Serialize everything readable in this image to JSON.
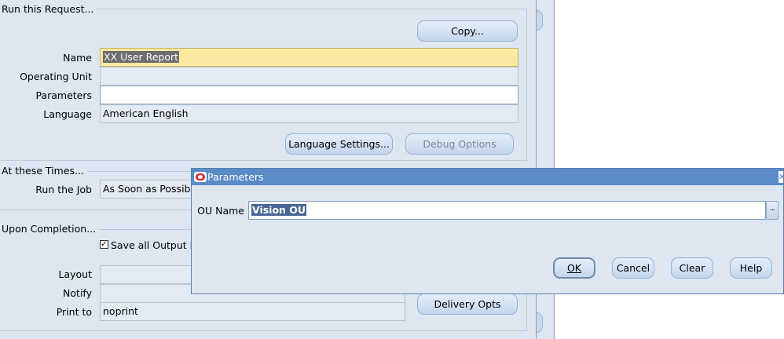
{
  "run_request": {
    "title": "Run this Request...",
    "copy_button": "Copy...",
    "name_label": "Name",
    "name_value": "XX User Report",
    "operating_unit_label": "Operating Unit",
    "operating_unit_value": "",
    "parameters_label": "Parameters",
    "parameters_value": "",
    "language_label": "Language",
    "language_value": "American English",
    "language_settings_button": "Language Settings...",
    "debug_options_button": "Debug Options"
  },
  "schedule": {
    "title": "At these Times...",
    "run_job_label": "Run the Job",
    "run_job_value": "As Soon as Possib"
  },
  "completion": {
    "title": "Upon Completion...",
    "save_output_checked": true,
    "save_output_label": "Save all Output F",
    "layout_label": "Layout",
    "layout_value": "",
    "notify_label": "Notify",
    "notify_value": "",
    "print_to_label": "Print to",
    "print_to_value": "noprint",
    "delivery_opts_button": "Delivery Opts"
  },
  "dialog": {
    "title": "Parameters",
    "ou_name_label": "OU Name",
    "ou_name_value": "Vision OU",
    "lov_label": "...",
    "ok_button": "OK",
    "cancel_button": "Cancel",
    "clear_button": "Clear",
    "help_button": "Help"
  },
  "colors": {
    "window_bg": "#dde6f1",
    "required_field": "#fbe8a1",
    "titlebar": "#5b8bc7",
    "button_border": "#98b4d4"
  }
}
